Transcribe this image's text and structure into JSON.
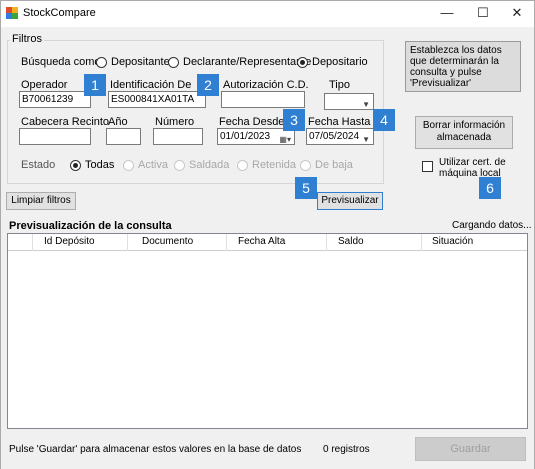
{
  "window": {
    "title": "StockCompare",
    "minimize": "—",
    "maximize": "☐",
    "close": "✕"
  },
  "filters": {
    "legend": "Filtros",
    "search_as_label": "Búsqueda como",
    "radio_depositante": "Depositante",
    "radio_declarante": "Declarante/Representante",
    "radio_depositario": "Depositario",
    "operador_label": "Operador",
    "operador_value": "B70061239",
    "identificacion_label": "Identificación Depósito",
    "identificacion_value": "ES000841XA01TA",
    "autorizacion_label": "Autorización C.D.",
    "autorizacion_value": "",
    "tipo_label": "Tipo",
    "tipo_value": "",
    "cabecera_label": "Cabecera Recinto",
    "anio_label": "Año",
    "numero_label": "Número",
    "fecha_desde_label": "Fecha Desde",
    "fecha_desde_value": "01/01/2023",
    "fecha_hasta_label": "Fecha Hasta",
    "fecha_hasta_value": "07/05/2024",
    "estado_label": "Estado",
    "estado_todas": "Todas",
    "estado_activa": "Activa",
    "estado_saldada": "Saldada",
    "estado_retenida": "Retenida",
    "estado_debaja": "De baja"
  },
  "info_box": "Establezca los datos que determinarán la consulta y pulse 'Previsualizar'",
  "borrar_button": "Borrar información almacenada",
  "utilizar_cert": "Utilizar cert. de máquina local",
  "limpiar_button": "Limpiar filtros",
  "previsualizar_button": "Previsualizar",
  "markers": [
    "1",
    "2",
    "3",
    "4",
    "5",
    "6"
  ],
  "preview": {
    "title": "Previsualización de la consulta",
    "status": "Cargando datos...",
    "columns": [
      "Id Depósito",
      "Documento",
      "Fecha Alta",
      "Saldo",
      "Situación"
    ]
  },
  "footer": {
    "hint": "Pulse 'Guardar' para almacenar estos valores en la base de datos",
    "count": "0 registros",
    "save_button": "Guardar"
  },
  "colors": {
    "marker": "#2f7fd3",
    "info_bg": "#dcdcdc",
    "client_bg": "#f0f0f0"
  }
}
